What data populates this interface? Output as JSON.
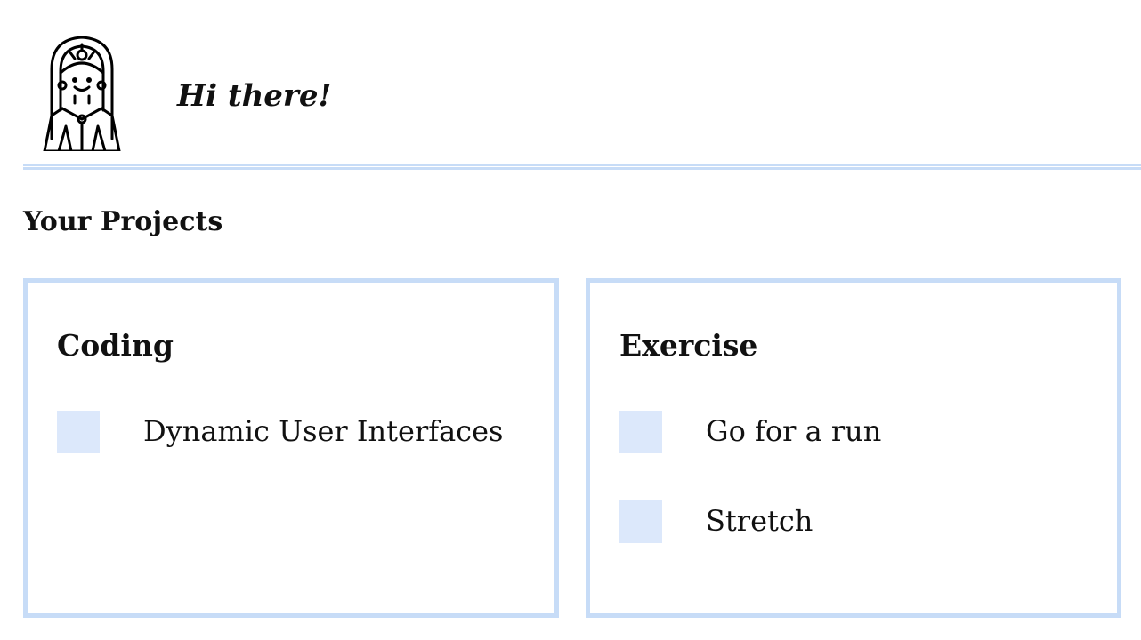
{
  "header": {
    "greeting": "Hi there!",
    "avatar_icon": "woman-avatar-icon"
  },
  "projects": {
    "section_title": "Your Projects",
    "border_color": "#c7dcf7",
    "checkbox_color": "#dce8fb",
    "cards": [
      {
        "title": "Coding",
        "tasks": [
          {
            "label": "Dynamic User Interfaces",
            "checked": false
          }
        ]
      },
      {
        "title": "Exercise",
        "tasks": [
          {
            "label": "Go for a run",
            "checked": false
          },
          {
            "label": "Stretch",
            "checked": false
          }
        ]
      }
    ]
  }
}
